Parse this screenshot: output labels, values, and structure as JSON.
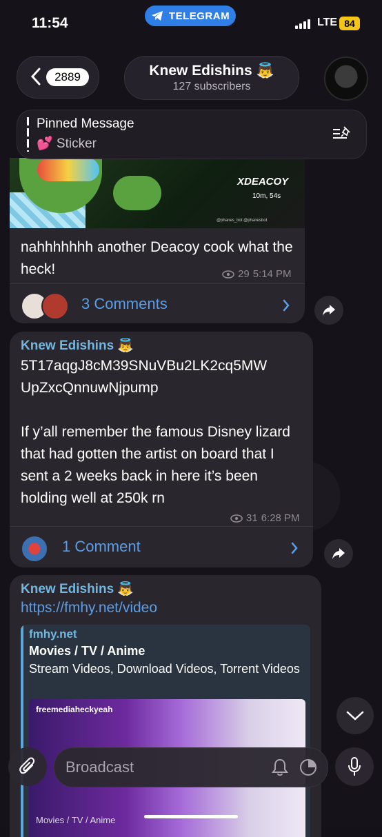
{
  "status": {
    "time": "11:54",
    "app_pill": "TELEGRAM",
    "network": "LTE",
    "battery": "84"
  },
  "header": {
    "back_count": "2889",
    "channel_name": "Knew Edishins 👼",
    "subscribers": "127 subscribers"
  },
  "pinned": {
    "title": "Pinned Message",
    "preview": "💕 Sticker"
  },
  "messages": [
    {
      "image_overlay": {
        "handle": "XDEACOY",
        "time": "10m, 54s",
        "footer": "@phanes_bot   @phanesbot"
      },
      "text": "nahhhhhhh another Deacoy cook what the heck!",
      "views": "29",
      "time": "5:14 PM",
      "comments": "3 Comments"
    },
    {
      "sender": "Knew Edishins 👼",
      "text_line1": "5T17aqgJ8cM39SNuVBu2LK2cq5MW",
      "text_line2": "UpZxcQnnuwNjpump",
      "text_para": "If y’all remember the famous Disney lizard that had gotten the artist on board that I sent a 2 weeks back in here it’s been holding well at 250k rn",
      "views": "31",
      "time": "6:28 PM",
      "comments": "1 Comment"
    },
    {
      "sender": "Knew Edishins 👼",
      "link": "https://fmhy.net/video",
      "preview": {
        "site": "fmhy.net",
        "title": "Movies / TV / Anime",
        "description": "Stream Videos, Download Videos, Torrent Videos",
        "image_label": "freemediaheckyeah",
        "image_footer": "Movies / TV / Anime"
      }
    }
  ],
  "input": {
    "placeholder": "Broadcast"
  },
  "colors": {
    "accent": "#5a9ee8",
    "sender": "#73b7e0",
    "bubble": "#2a262e",
    "telegram_blue": "#2f7fe6"
  }
}
